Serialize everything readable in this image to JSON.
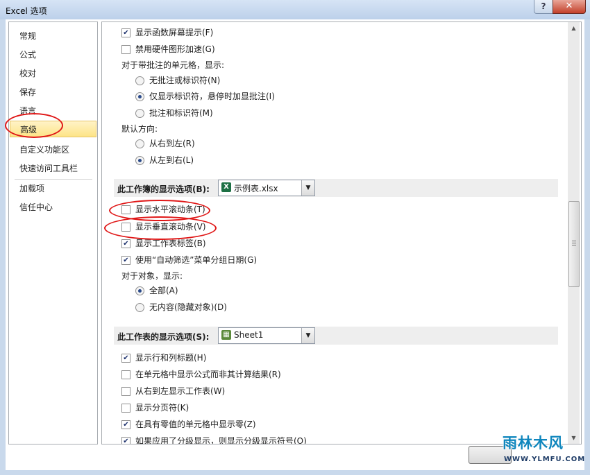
{
  "window": {
    "title": "Excel 选项",
    "help_label": "?",
    "close_label": "✕"
  },
  "nav": {
    "items": [
      {
        "label": "常规"
      },
      {
        "label": "公式"
      },
      {
        "label": "校对"
      },
      {
        "label": "保存"
      },
      {
        "label": "语言"
      },
      {
        "label": "高级",
        "selected": true
      },
      {
        "label": "自定义功能区"
      },
      {
        "label": "快速访问工具栏"
      },
      {
        "label": "加载项"
      },
      {
        "label": "信任中心"
      }
    ]
  },
  "settings": {
    "items": [
      {
        "type": "checkbox",
        "checked": true,
        "label": "显示函数屏幕提示(F)"
      },
      {
        "type": "checkbox",
        "checked": false,
        "label": "禁用硬件图形加速(G)"
      },
      {
        "type": "text",
        "label": "对于带批注的单元格，显示:"
      },
      {
        "type": "radio",
        "checked": false,
        "label": "无批注或标识符(N)"
      },
      {
        "type": "radio",
        "checked": true,
        "label": "仅显示标识符，悬停时加显批注(I)"
      },
      {
        "type": "radio",
        "checked": false,
        "label": "批注和标识符(M)"
      },
      {
        "type": "text",
        "label": "默认方向:"
      },
      {
        "type": "radio",
        "checked": false,
        "label": "从右到左(R)"
      },
      {
        "type": "radio",
        "checked": true,
        "label": "从左到右(L)"
      }
    ]
  },
  "workbook": {
    "section_title": "此工作簿的显示选项(B):",
    "combo_value": "示例表.xlsx",
    "items": [
      {
        "type": "checkbox",
        "checked": false,
        "label": "显示水平滚动条(T)"
      },
      {
        "type": "checkbox",
        "checked": false,
        "label": "显示垂直滚动条(V)"
      },
      {
        "type": "checkbox",
        "checked": true,
        "label": "显示工作表标签(B)"
      },
      {
        "type": "checkbox",
        "checked": true,
        "label": "使用“自动筛选”菜单分组日期(G)"
      },
      {
        "type": "text",
        "label": "对于对象，显示:"
      },
      {
        "type": "radio",
        "checked": true,
        "label": "全部(A)"
      },
      {
        "type": "radio",
        "checked": false,
        "label": "无内容(隐藏对象)(D)"
      }
    ]
  },
  "worksheet": {
    "section_title": "此工作表的显示选项(S):",
    "combo_value": "Sheet1",
    "items": [
      {
        "type": "checkbox",
        "checked": true,
        "label": "显示行和列标题(H)"
      },
      {
        "type": "checkbox",
        "checked": false,
        "label": "在单元格中显示公式而非其计算结果(R)"
      },
      {
        "type": "checkbox",
        "checked": false,
        "label": "从右到左显示工作表(W)"
      },
      {
        "type": "checkbox",
        "checked": false,
        "label": "显示分页符(K)"
      },
      {
        "type": "checkbox",
        "checked": true,
        "label": "在具有零值的单元格中显示零(Z)"
      },
      {
        "type": "checkbox",
        "checked": true,
        "label": "如果应用了分级显示，则显示分级显示符号(O)"
      }
    ]
  },
  "watermark": {
    "title": "雨林木风",
    "url": "WWW.YLMFU.COM"
  }
}
